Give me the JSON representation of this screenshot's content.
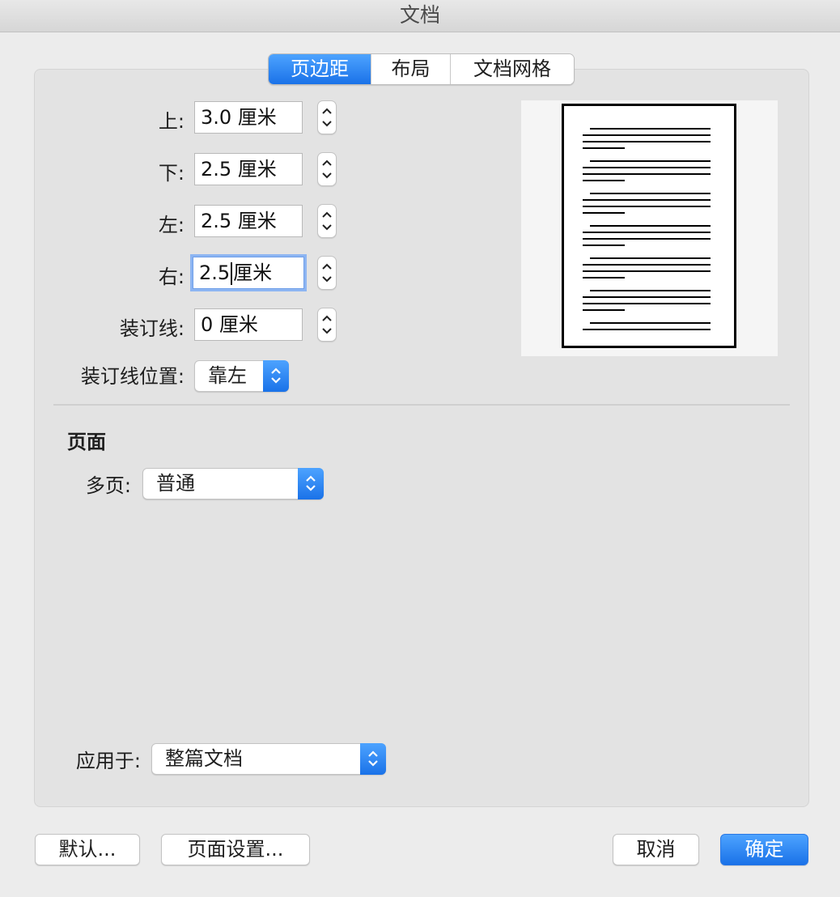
{
  "window": {
    "title": "文档"
  },
  "tabs": [
    {
      "label": "页边距",
      "active": true
    },
    {
      "label": "布局",
      "active": false
    },
    {
      "label": "文档网格",
      "active": false
    }
  ],
  "margins": {
    "top": {
      "label": "上:",
      "value": "3.0 厘米"
    },
    "bottom": {
      "label": "下:",
      "value": "2.5 厘米"
    },
    "left": {
      "label": "左:",
      "value": "2.5 厘米"
    },
    "right": {
      "label": "右:",
      "value_before_caret": "2.5",
      "value_after_caret": "厘米"
    },
    "gutter": {
      "label": "装订线:",
      "value": "0 厘米"
    },
    "gutter_position": {
      "label": "装订线位置:",
      "value": "靠左"
    }
  },
  "pages": {
    "section_title": "页面",
    "multiple_label": "多页:",
    "multiple_value": "普通"
  },
  "apply_to": {
    "label": "应用于:",
    "value": "整篇文档"
  },
  "buttons": {
    "default": "默认...",
    "page_setup": "页面设置...",
    "cancel": "取消",
    "ok": "确定"
  },
  "colors": {
    "accent": "#1a72e8",
    "focus_ring": "#8db5f2"
  }
}
